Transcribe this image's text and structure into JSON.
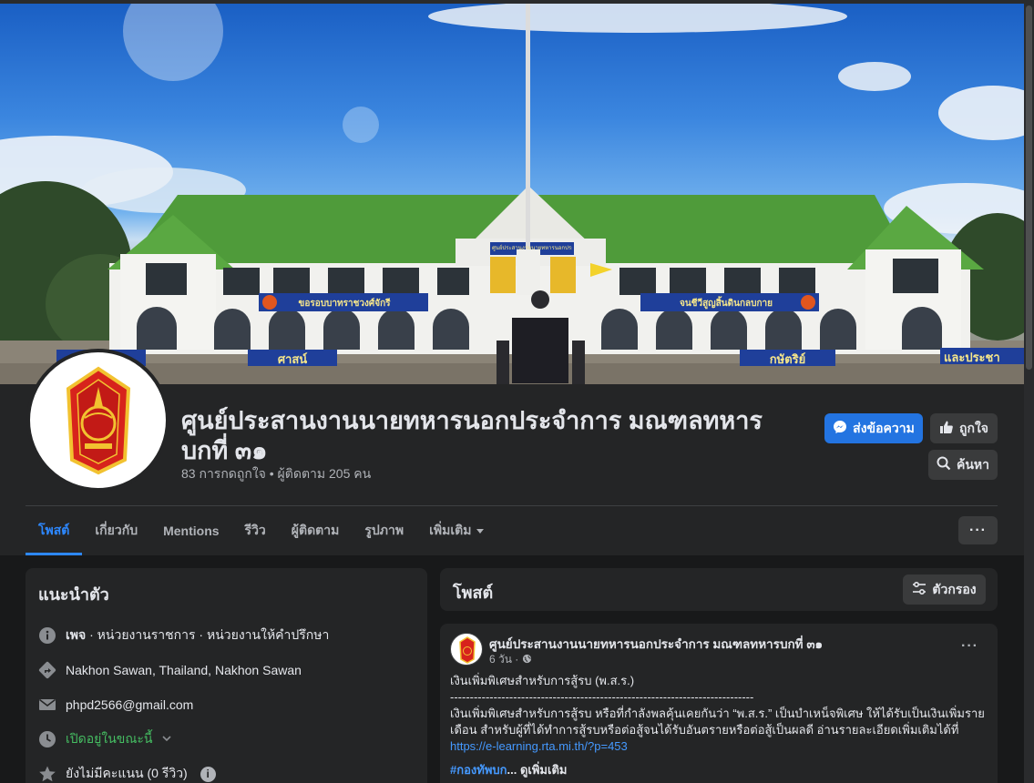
{
  "page": {
    "title": "ศูนย์ประสานงานนายทหารนอกประจำการ มณฑลทหารบกที่ ๓๑",
    "stats": "83 การกดถูกใจ • ผู้ติดตาม 205 คน"
  },
  "cover": {
    "banner_left": "ขอรอบบาทราชวงศ์จักรี",
    "banner_right": "จนชีวีสูญสิ้นดินกลบกาย",
    "banner_center_top": "ศูนย์ประสานงานนายทหารนอกประจำการ",
    "sign_1": "ศาสน์",
    "sign_2": "กษัตริย์",
    "sign_3": "และประชา"
  },
  "actions": {
    "message_label": "ส่งข้อความ",
    "like_label": "ถูกใจ",
    "search_label": "ค้นหา",
    "more_label": "···"
  },
  "tabs": [
    {
      "label": "โพสต์"
    },
    {
      "label": "เกี่ยวกับ"
    },
    {
      "label": "Mentions"
    },
    {
      "label": "รีวิว"
    },
    {
      "label": "ผู้ติดตาม"
    },
    {
      "label": "รูปภาพ"
    },
    {
      "label": "เพิ่มเติม"
    }
  ],
  "intro": {
    "heading": "แนะนำตัว",
    "category_prefix": "เพจ",
    "category": " · หน่วยงานราชการ · หน่วยงานให้คำปรึกษา",
    "location": "Nakhon Sawan, Thailand, Nakhon Sawan",
    "email": "phpd2566@gmail.com",
    "hours": "เปิดอยู่ในขณะนี้",
    "rating": "ยังไม่มีคะแนน (0 รีวิว)",
    "info_glyph": "i"
  },
  "posts": {
    "heading": "โพสต์",
    "filter_label": "ตัวกรอง"
  },
  "post": {
    "author": "ศูนย์ประสานงานนายทหารนอกประจำการ มณฑลทหารบกที่ ๓๑",
    "time": "6 วัน ·",
    "line1": "เงินเพิ่มพิเศษสำหรับการสู้รบ (พ.ส.ร.)",
    "separator": "-----------------------------------------------------------------------------",
    "line2": "เงินเพิ่มพิเศษสำหรับการสู้รบ หรือที่กำลังพลคุ้นเคยกันว่า “พ.ส.ร.” เป็นบำเหน็จพิเศษ ให้ได้รับเป็นเงินเพิ่มราย",
    "line3": "เดือน สำหรับผู้ที่ได้ทำการสู้รบหรือต่อสู้จนได้รับอันตรายหรือต่อสู้เป็นผลดี อ่านรายละเอียดเพิ่มเติมได้ที่",
    "link": "https://e-learning.rta.mi.th/?p=453",
    "hashtag": "#กองทัพบก",
    "see_more": "... ดูเพิ่มเติม"
  },
  "colors": {
    "accent": "#2d88ff",
    "message_button": "#2374e1",
    "open_status": "#45bd62",
    "card_bg": "#242526",
    "page_bg": "#18191a"
  },
  "icons": [
    "messenger-icon",
    "thumbs-up-icon",
    "search-icon",
    "info-icon",
    "directions-icon",
    "mail-icon",
    "clock-icon",
    "star-icon",
    "filter-icon",
    "globe-icon",
    "caret-down-icon",
    "chevron-down-icon"
  ]
}
